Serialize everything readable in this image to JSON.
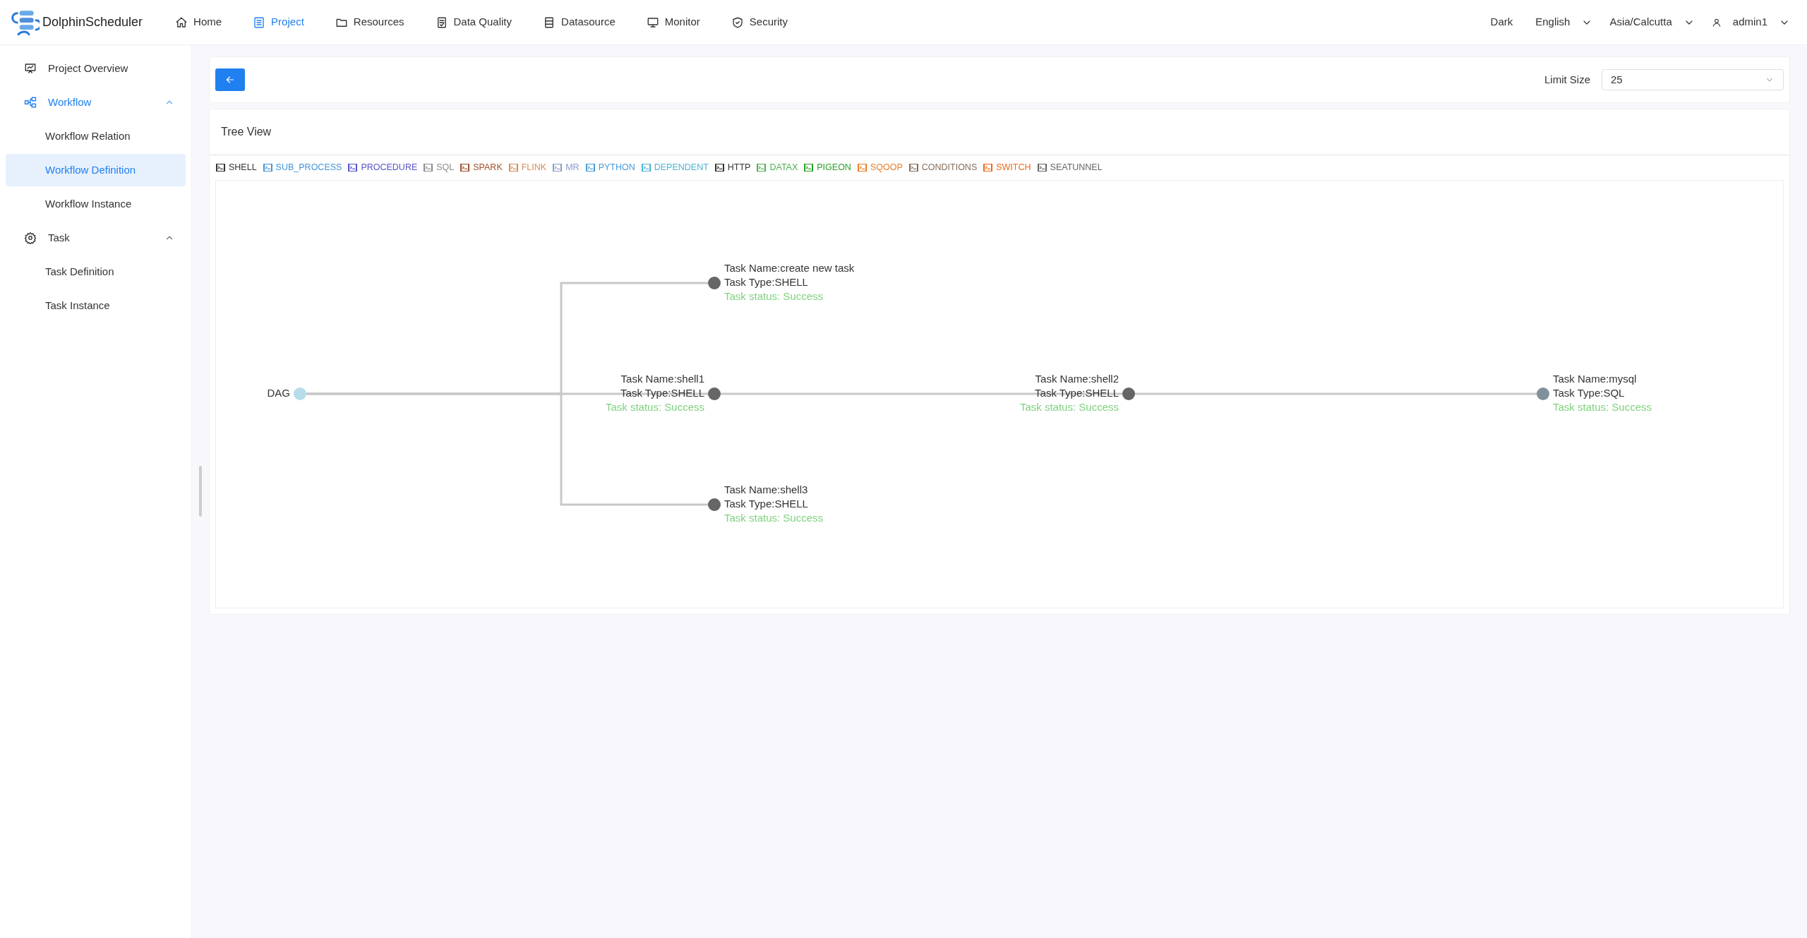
{
  "header": {
    "brand": "DolphinScheduler",
    "nav": [
      {
        "label": "Home",
        "selected": false
      },
      {
        "label": "Project",
        "selected": true
      },
      {
        "label": "Resources",
        "selected": false
      },
      {
        "label": "Data Quality",
        "selected": false
      },
      {
        "label": "Datasource",
        "selected": false
      },
      {
        "label": "Monitor",
        "selected": false
      },
      {
        "label": "Security",
        "selected": false
      }
    ],
    "theme": "Dark",
    "language": "English",
    "timezone": "Asia/Calcutta",
    "user": "admin1"
  },
  "sidebar": {
    "items": [
      {
        "label": "Project Overview",
        "selected": false
      },
      {
        "label": "Workflow",
        "expanded": true,
        "children": [
          {
            "label": "Workflow Relation",
            "selected": false
          },
          {
            "label": "Workflow Definition",
            "selected": true
          },
          {
            "label": "Workflow Instance",
            "selected": false
          }
        ]
      },
      {
        "label": "Task",
        "expanded": true,
        "children": [
          {
            "label": "Task Definition",
            "selected": false
          },
          {
            "label": "Task Instance",
            "selected": false
          }
        ]
      }
    ]
  },
  "toolbar": {
    "limit_label": "Limit Size",
    "limit_value": "25"
  },
  "tree_view": {
    "title": "Tree View",
    "legend": [
      {
        "label": "SHELL",
        "color": "#333333"
      },
      {
        "label": "SUB_PROCESS",
        "color": "#4295da"
      },
      {
        "label": "PROCEDURE",
        "color": "#5654c8"
      },
      {
        "label": "SQL",
        "color": "#8c8c8c"
      },
      {
        "label": "SPARK",
        "color": "#a0522d"
      },
      {
        "label": "FLINK",
        "color": "#d68b5a"
      },
      {
        "label": "MR",
        "color": "#8a9bc4"
      },
      {
        "label": "PYTHON",
        "color": "#4a9bd8"
      },
      {
        "label": "DEPENDENT",
        "color": "#4fb3d4"
      },
      {
        "label": "HTTP",
        "color": "#333333"
      },
      {
        "label": "DATAX",
        "color": "#4caf50"
      },
      {
        "label": "PIGEON",
        "color": "#2ca02c"
      },
      {
        "label": "SQOOP",
        "color": "#e87e29"
      },
      {
        "label": "CONDITIONS",
        "color": "#856c5a"
      },
      {
        "label": "SWITCH",
        "color": "#f06a1a"
      },
      {
        "label": "SEATUNNEL",
        "color": "#666666"
      }
    ],
    "tree": {
      "label": "DAG",
      "color": "#b7dcea",
      "children": [
        {
          "name": "Task Name:create new task",
          "type": "Task Type:SHELL",
          "status": "Task status: Success",
          "color": "#666666"
        },
        {
          "name": "Task Name:shell1",
          "type": "Task Type:SHELL",
          "status": "Task status: Success",
          "color": "#666666",
          "children": [
            {
              "name": "Task Name:shell2",
              "type": "Task Type:SHELL",
              "status": "Task status: Success",
              "color": "#666666",
              "children": [
                {
                  "name": "Task Name:mysql",
                  "type": "Task Type:SQL",
                  "status": "Task status: Success",
                  "color": "#7f929c"
                }
              ]
            }
          ]
        },
        {
          "name": "Task Name:shell3",
          "type": "Task Type:SHELL",
          "status": "Task status: Success",
          "color": "#666666"
        }
      ]
    }
  }
}
